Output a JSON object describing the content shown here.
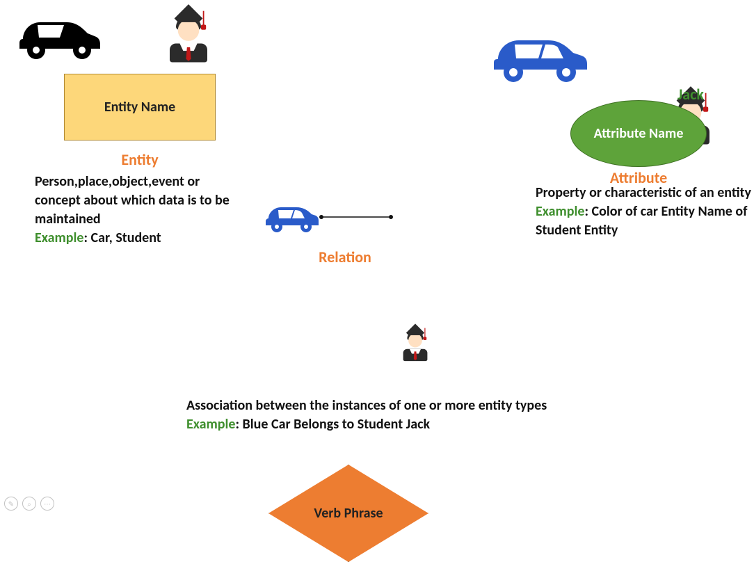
{
  "entity": {
    "shape_text": "Entity Name",
    "heading": "Entity",
    "desc": "Person,place,object,event or concept about which data is to be maintained",
    "example_key": "Example",
    "example_val": ": Car, Student"
  },
  "attribute": {
    "shape_text": "Attribute Name",
    "heading": "Attribute",
    "jack_label": "Jack",
    "desc": "Property or characteristic of an entity",
    "example_key": "Example",
    "example_val": ": Color of car Entity Name of Student Entity"
  },
  "relation": {
    "shape_text": "Verb Phrase",
    "heading": "Relation",
    "desc": "Association between the instances of one or more entity types",
    "example_key": "Example",
    "example_val": ": Blue Car Belongs to Student Jack"
  },
  "icons": {
    "car_black": "car-icon",
    "car_blue": "car-icon",
    "student": "student-icon"
  }
}
